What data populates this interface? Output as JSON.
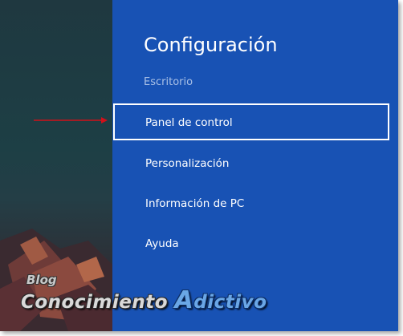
{
  "settings_panel": {
    "title": "Configuración",
    "context": "Escritorio",
    "items": [
      {
        "label": "Panel de control",
        "selected": true
      },
      {
        "label": "Personalización",
        "selected": false
      },
      {
        "label": "Información de PC",
        "selected": false
      },
      {
        "label": "Ayuda",
        "selected": false
      }
    ]
  },
  "watermark": {
    "blog": "Blog",
    "name_part1": "Conocimiento",
    "name_part2_initial": "A",
    "name_part2_rest": "dictivo"
  },
  "colors": {
    "panel_background": "#1852b4",
    "subtitle_text": "#a9c0e6",
    "arrow": "#d0101a",
    "watermark_accent": "#6aa7e6"
  },
  "icons": {
    "annotation": "red-arrow-icon"
  }
}
